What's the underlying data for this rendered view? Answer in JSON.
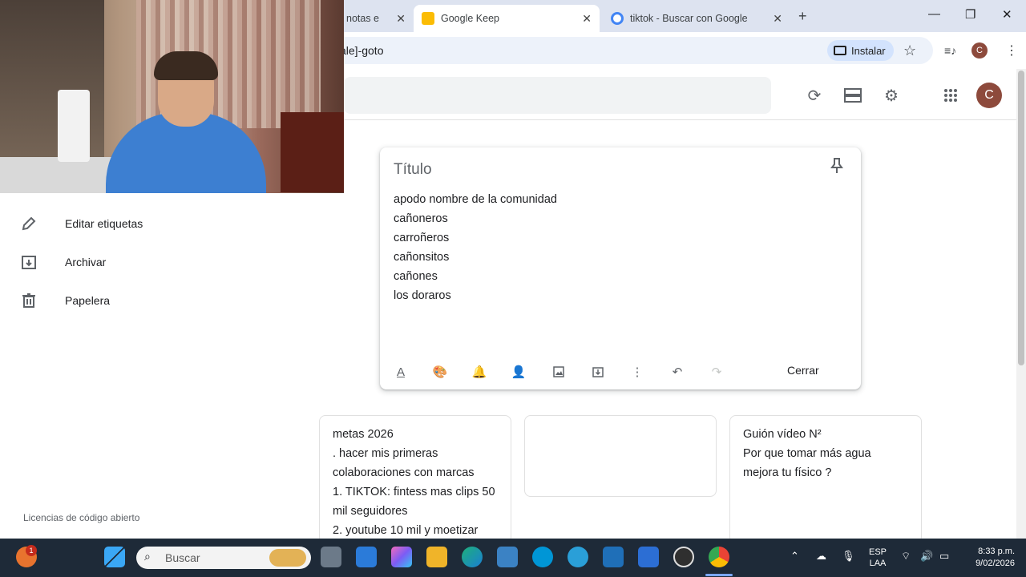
{
  "browser": {
    "tabs": [
      {
        "title": "notas e",
        "active": false
      },
      {
        "title": "Google Keep",
        "active": true
      },
      {
        "title": "tiktok - Buscar con Google",
        "active": false
      }
    ],
    "url": "ale]-goto",
    "install_label": "Instalar",
    "profile_initial": "C"
  },
  "keep": {
    "avatar_initial": "C",
    "sidebar": [
      {
        "label": "Editar etiquetas",
        "icon": "pencil-icon"
      },
      {
        "label": "Archivar",
        "icon": "archive-icon"
      },
      {
        "label": "Papelera",
        "icon": "trash-icon"
      }
    ],
    "licenses": "Licencias de código abierto",
    "editor": {
      "title_placeholder": "Título",
      "lines": [
        "apodo nombre de la comunidad",
        "cañoneros",
        "carroñeros",
        "cañonsitos",
        "cañones",
        "los doraros"
      ],
      "close_label": "Cerrar"
    },
    "cards": [
      {
        "lines": [
          "metas 2026",
          ". hacer mis primeras",
          "colaboraciones con marcas",
          "1. TIKTOK: fintess mas clips 50",
          "mil seguidores",
          "2. youtube 10 mil y moetizar"
        ]
      },
      {
        "lines": []
      },
      {
        "lines": [
          "Guión vídeo N²",
          "Por que tomar más agua",
          "mejora tu físico ?"
        ]
      }
    ]
  },
  "taskbar": {
    "search_label": "Buscar",
    "notification_count": "1",
    "lang_line1": "ESP",
    "lang_line2": "LAA",
    "time": "8:33 p.m.",
    "date": "9/02/2026"
  },
  "colors": {
    "tabstrip": "#dde3f0",
    "accent": "#1a73e8",
    "avatar": "#8d4a3c",
    "taskbar": "#1e2a38"
  }
}
